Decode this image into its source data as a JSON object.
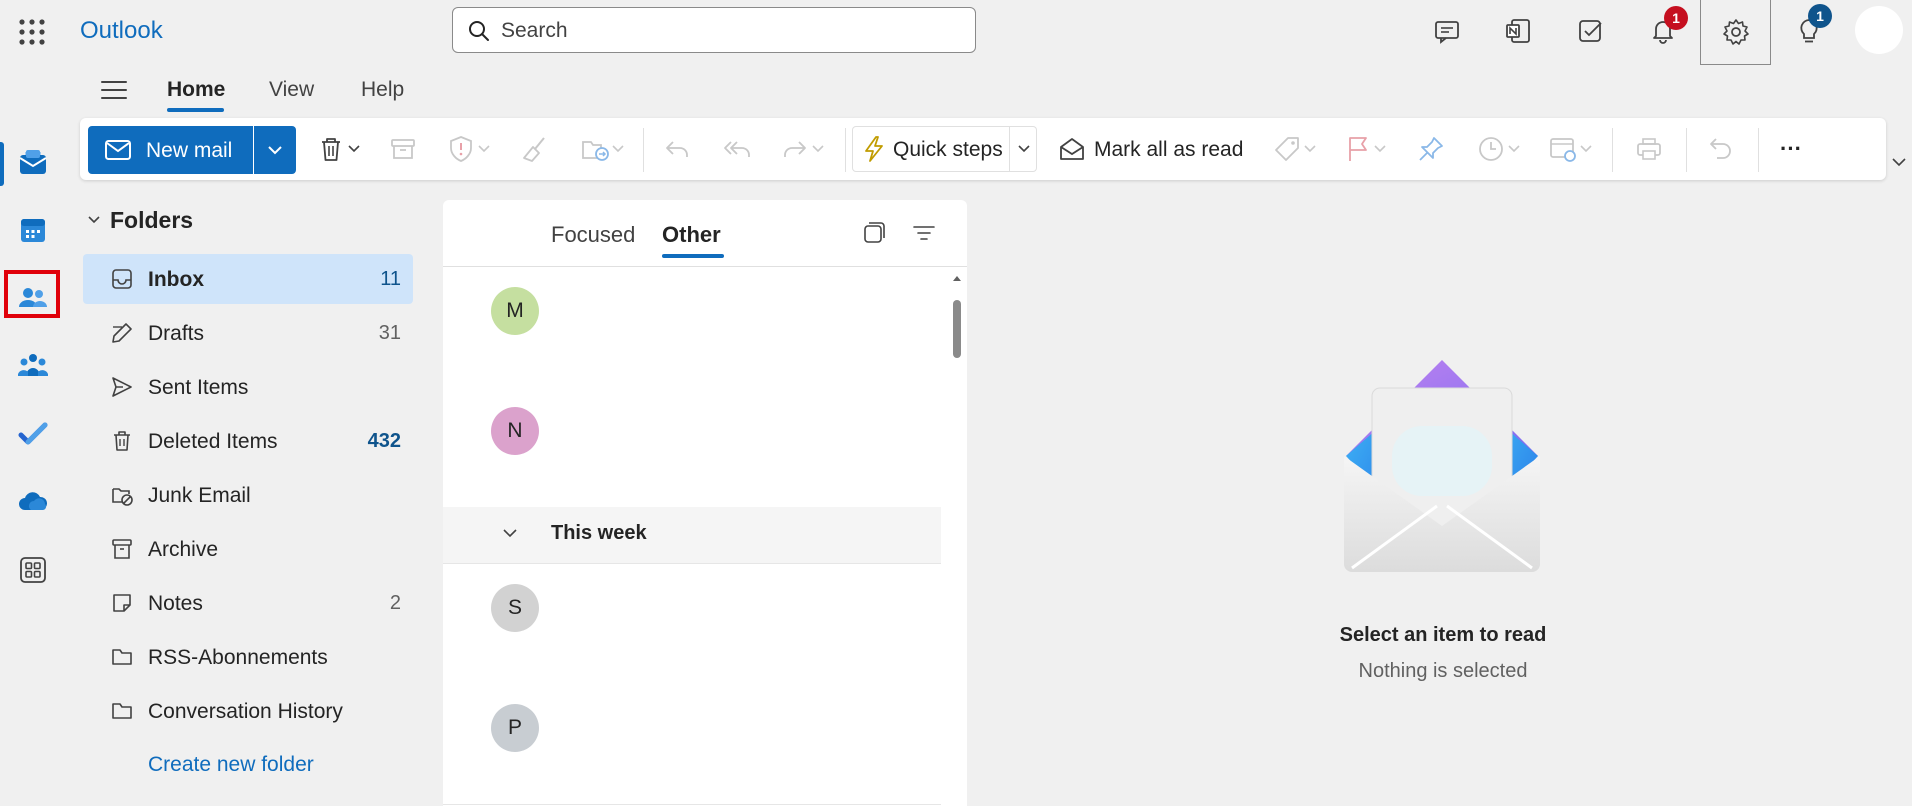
{
  "app": {
    "title": "Outlook"
  },
  "search": {
    "placeholder": "Search"
  },
  "topbar": {
    "notifications_badge": "1",
    "tips_badge": "1"
  },
  "tabs": [
    {
      "label": "Home"
    },
    {
      "label": "View"
    },
    {
      "label": "Help"
    }
  ],
  "ribbon": {
    "new_mail": "New mail",
    "quick_steps": "Quick steps",
    "mark_all_read": "Mark all as read",
    "more": "···"
  },
  "folders": {
    "header": "Folders",
    "items": [
      {
        "name": "Inbox",
        "count": "11",
        "icon": "inbox-icon"
      },
      {
        "name": "Drafts",
        "count": "31",
        "icon": "pencil-icon"
      },
      {
        "name": "Sent Items",
        "count": "",
        "icon": "send-icon"
      },
      {
        "name": "Deleted Items",
        "count": "432",
        "icon": "trash-icon"
      },
      {
        "name": "Junk Email",
        "count": "",
        "icon": "junk-icon"
      },
      {
        "name": "Archive",
        "count": "",
        "icon": "archive-icon"
      },
      {
        "name": "Notes",
        "count": "2",
        "icon": "note-icon"
      },
      {
        "name": "RSS-Abonnements",
        "count": "",
        "icon": "folder-icon"
      },
      {
        "name": "Conversation History",
        "count": "",
        "icon": "folder-icon"
      }
    ],
    "create_new": "Create new folder"
  },
  "message_list": {
    "tab_focused": "Focused",
    "tab_other": "Other",
    "group_label": "This week",
    "messages": [
      {
        "initial": "M",
        "color": "#c5dfa0"
      },
      {
        "initial": "N",
        "color": "#dba2cc"
      },
      {
        "initial": "S",
        "color": "#d2d2d2"
      },
      {
        "initial": "P",
        "color": "#c8cdd2"
      }
    ]
  },
  "reading_pane": {
    "title": "Select an item to read",
    "subtitle": "Nothing is selected"
  },
  "colors": {
    "accent": "#0f6cbd",
    "badge_red": "#c50f1f",
    "badge_blue": "#0f548c",
    "highlight_box": "#e0000a"
  }
}
